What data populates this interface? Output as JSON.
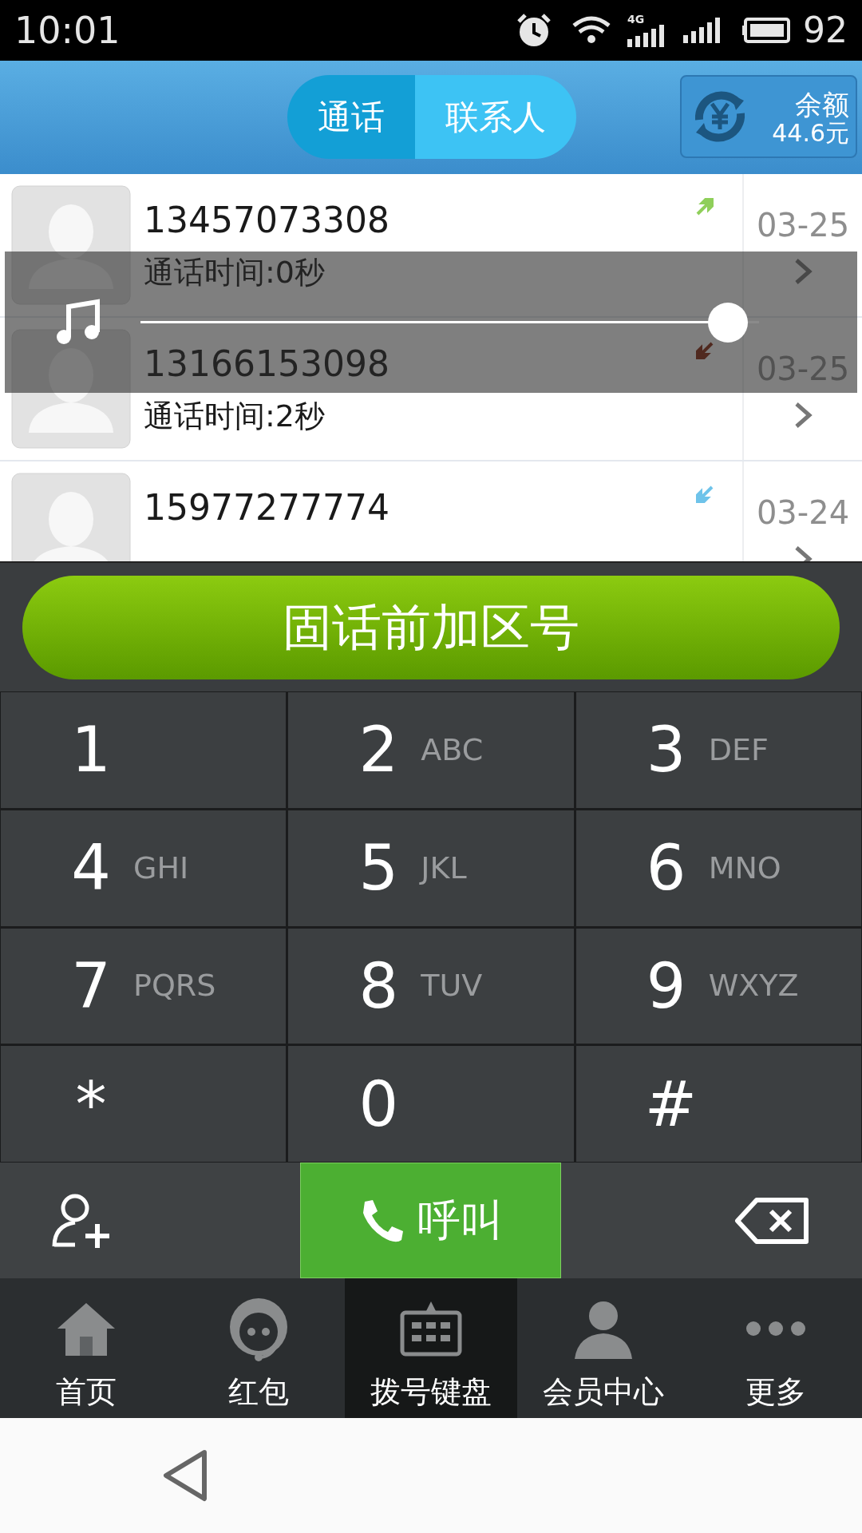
{
  "status_bar": {
    "time": "10:01",
    "network": "4G",
    "battery": "92"
  },
  "header": {
    "tabs": [
      {
        "label": "通话",
        "selected": true
      },
      {
        "label": "联系人",
        "selected": false
      }
    ],
    "balance": {
      "label": "余额",
      "amount": "44.6元"
    }
  },
  "calls": [
    {
      "number": "13457073308",
      "duration": "通话时间:0秒",
      "kind": "outgoing",
      "date": "03-25"
    },
    {
      "number": "13166153098",
      "duration": "通话时间:2秒",
      "kind": "missed",
      "date": "03-25"
    },
    {
      "number": "15977277774",
      "kind": "incoming",
      "date": "03-24"
    }
  ],
  "volume_overlay": {
    "level": 0.95
  },
  "prefix_button": "固话前加区号",
  "keypad": [
    {
      "digit": "1"
    },
    {
      "digit": "2",
      "letters": "ABC"
    },
    {
      "digit": "3",
      "letters": "DEF"
    },
    {
      "digit": "4",
      "letters": "GHI"
    },
    {
      "digit": "5",
      "letters": "JKL"
    },
    {
      "digit": "6",
      "letters": "MNO"
    },
    {
      "digit": "7",
      "letters": "PQRS"
    },
    {
      "digit": "8",
      "letters": "TUV"
    },
    {
      "digit": "9",
      "letters": "WXYZ"
    },
    {
      "digit": "*"
    },
    {
      "digit": "0"
    },
    {
      "digit": "#"
    }
  ],
  "call_button": "呼叫",
  "bottom_nav": [
    {
      "label": "首页",
      "kind": "home",
      "selected": false
    },
    {
      "label": "红包",
      "kind": "service",
      "selected": false
    },
    {
      "label": "拨号键盘",
      "kind": "dialpad",
      "selected": true
    },
    {
      "label": "会员中心",
      "kind": "member",
      "selected": false
    },
    {
      "label": "更多",
      "kind": "more",
      "selected": false
    }
  ]
}
